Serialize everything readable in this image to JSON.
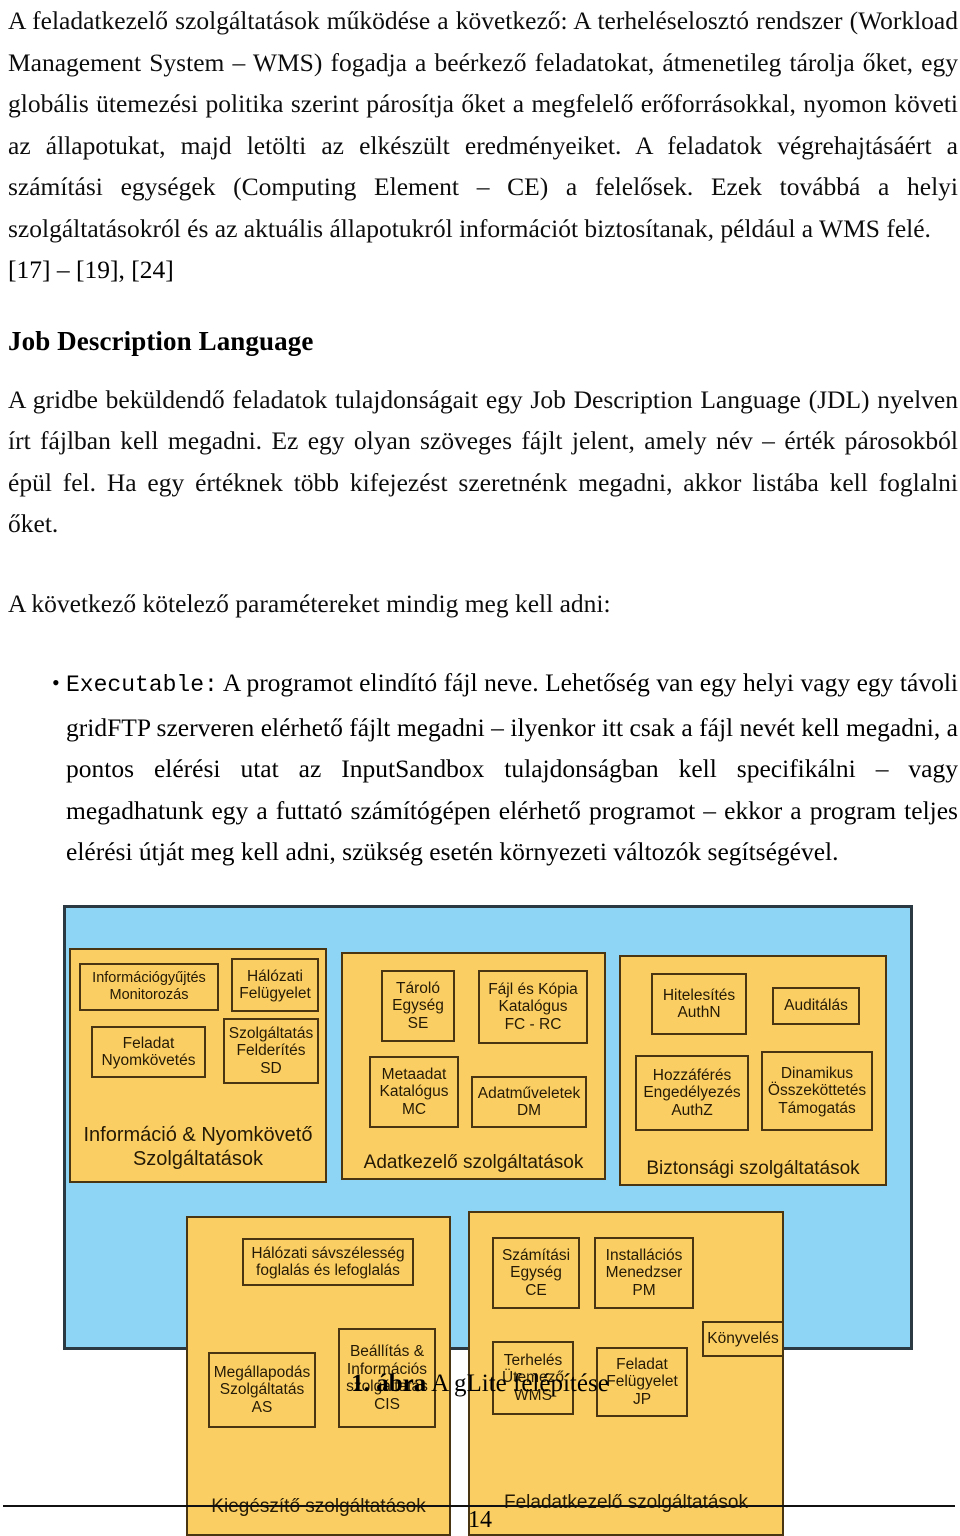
{
  "document": {
    "body_paragraphs": [
      "A feladatkezelő szolgáltatások működése a következő: A terheléselosztó rendszer (Workload Management System – WMS) fogadja a beérkező feladatokat, átmenetileg tárolja őket, egy globális ütemezési politika szerint párosítja őket a megfelelő erőforrásokkal, nyomon követi az állapotukat, majd letölti az elkészült eredményeiket. A feladatok végrehajtásáért a számítási egységek (Computing Element – CE) a felelősek. Ezek továbbá a helyi szolgáltatásokról és az aktuális állapotukról információt biztosítanak, például a WMS felé."
    ],
    "reference_line": "[17] – [19], [24]",
    "heading": "Job Description Language",
    "paragraph_after_heading": "A gridbe beküldendő feladatok tulajdonságait egy Job Description Language (JDL) nyelven írt fájlban kell megadni. Ez egy olyan szöveges fájlt jelent, amely név – érték párosokból épül fel. Ha egy értéknek több kifejezést szeretnénk megadni, akkor listába kell foglalni őket.",
    "lead_in": "A következő kötelező paramétereket mindig meg kell adni:",
    "bullets": [
      {
        "marker": "•",
        "code_term": "Executable:",
        "text": " A programot elindító fájl neve. Lehetőség van egy helyi vagy egy távoli gridFTP szerveren elérhető fájlt megadni – ilyenkor itt csak a fájl nevét kell megadni, a pontos elérési utat az InputSandbox tulajdonságban kell specifikálni – vagy megadhatunk egy a futtató számítógépen elérhető programot – ekkor a program teljes elérési útját meg kell adni, szükség esetén környezeti változók segítségével."
      }
    ]
  },
  "figure": {
    "caption_label": "1. ábra",
    "caption_text": " A gLite felépítése",
    "colors": {
      "background": "#8ed4f5",
      "panel_fill": "#fbce63",
      "panel_border": "#4a3513",
      "outer_border": "#2b3a42"
    },
    "panels": [
      {
        "id": "information-monitoring",
        "title": "Információ & Nyomkövető\nSzolgáltatások",
        "boxes": [
          {
            "id": "info-gathering-monitoring",
            "label": "Információgyűjtés\nMonitorozás"
          },
          {
            "id": "network-supervision",
            "label": "Hálózati\nFelügyelet"
          },
          {
            "id": "task-tracking",
            "label": "Feladat\nNyomkövetés"
          },
          {
            "id": "service-discovery",
            "label": "Szolgáltatás\nFelderítés\nSD"
          }
        ]
      },
      {
        "id": "data-management",
        "title": "Adatkezelő szolgáltatások",
        "boxes": [
          {
            "id": "storage-element",
            "label": "Tároló\nEgység\nSE"
          },
          {
            "id": "file-replica-catalog",
            "label": "Fájl és Kópia\nKatalógus\nFC - RC"
          },
          {
            "id": "metadata-catalog",
            "label": "Metaadat\nKatalógus\nMC"
          },
          {
            "id": "data-management-dm",
            "label": "Adatműveletek\nDM"
          }
        ]
      },
      {
        "id": "security-services",
        "title": "Biztonsági szolgáltatások",
        "boxes": [
          {
            "id": "authentication",
            "label": "Hitelesítés\nAuthN"
          },
          {
            "id": "auditing",
            "label": "Auditálás"
          },
          {
            "id": "authorization",
            "label": "Hozzáférés\nEngedélyezés\nAuthZ"
          },
          {
            "id": "dynamic-connectivity",
            "label": "Dinamikus\nÖsszeköttetés\nTámogatás"
          }
        ]
      },
      {
        "id": "auxiliary-services",
        "title": "Kiegészítő szolgáltatások",
        "boxes": [
          {
            "id": "network-bandwidth",
            "label": "Hálózati sávszélesség\nfoglalás és lefoglalás"
          },
          {
            "id": "agreement-service",
            "label": "Megállapodás\nSzolgáltatás\nAS"
          },
          {
            "id": "config-information-service",
            "label": "Beállítás &\nInformációs\nszolgáltatás\nCIS"
          }
        ]
      },
      {
        "id": "job-management-services",
        "title": "Feladatkezelő szolgáltatások",
        "boxes": [
          {
            "id": "computing-element",
            "label": "Számítási\nEgység\nCE"
          },
          {
            "id": "package-manager",
            "label": "Installációs\nMenedzser\nPM"
          },
          {
            "id": "accounting",
            "label": "Könyvelés"
          },
          {
            "id": "workload-manager",
            "label": "Terhelés\nÜtemező\nWMS"
          },
          {
            "id": "job-provenance",
            "label": "Feladat\nFelügyelet\nJP"
          }
        ]
      }
    ]
  },
  "footer": {
    "page_number": "14"
  }
}
